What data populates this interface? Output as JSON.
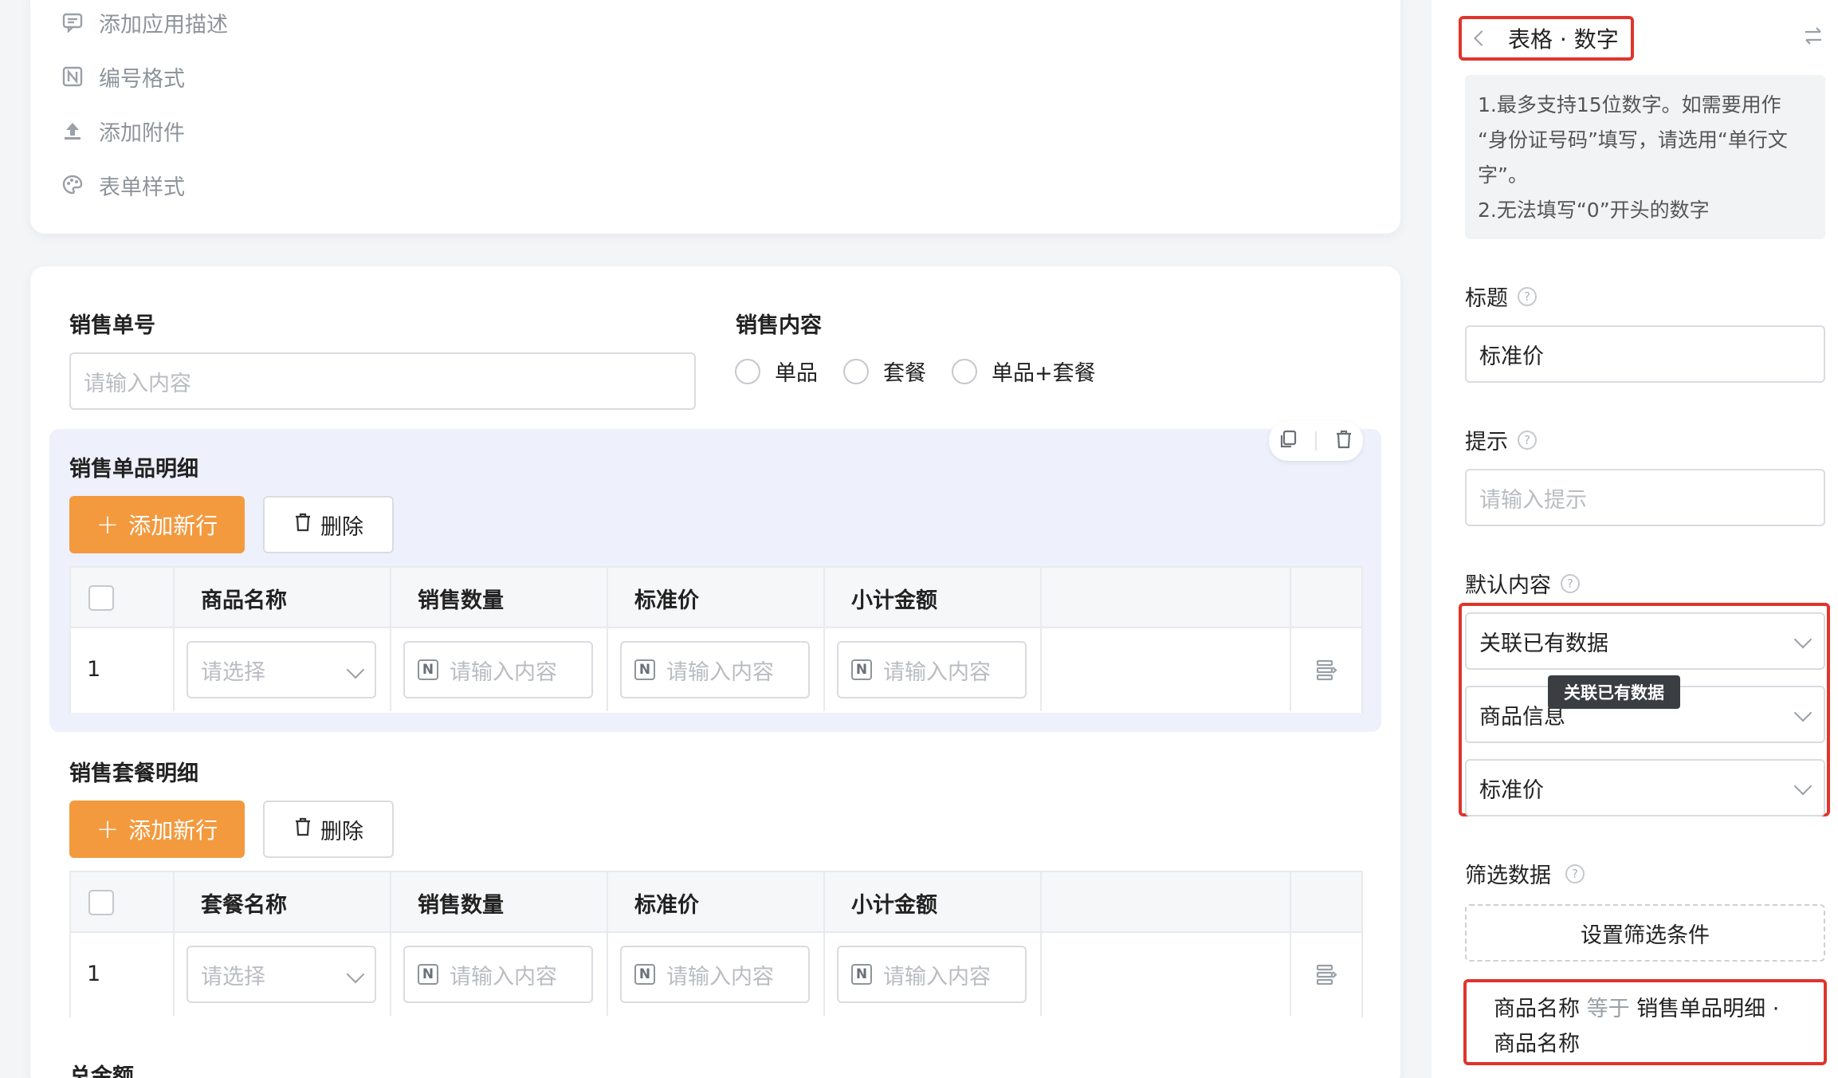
{
  "form_settings_menu": [
    {
      "label": "添加应用描述",
      "icon": "comment-icon"
    },
    {
      "label": "编号格式",
      "icon": "number-format-icon"
    },
    {
      "label": "添加附件",
      "icon": "upload-icon"
    },
    {
      "label": "表单样式",
      "icon": "palette-icon"
    }
  ],
  "form": {
    "order_no_label": "销售单号",
    "order_no_placeholder": "请输入内容",
    "content_label": "销售内容",
    "content_options": [
      "单品",
      "套餐",
      "单品+套餐"
    ]
  },
  "single_table": {
    "title": "销售单品明细",
    "add_label": "添加新行",
    "delete_label": "删除",
    "columns": [
      "商品名称",
      "销售数量",
      "标准价",
      "小计金额"
    ],
    "row_number": "1",
    "select_placeholder": "请选择",
    "input_placeholder": "请输入内容"
  },
  "package_table": {
    "title": "销售套餐明细",
    "add_label": "添加新行",
    "delete_label": "删除",
    "columns": [
      "套餐名称",
      "销售数量",
      "标准价",
      "小计金额"
    ],
    "row_number": "1",
    "select_placeholder": "请选择",
    "input_placeholder": "请输入内容"
  },
  "total_label": "总金额",
  "panel": {
    "breadcrumb": "表格 · 数字",
    "tip_lines": [
      "1.最多支持15位数字。如需要用作",
      "“身份证号码”填写，请选用“单行文",
      "字”。",
      "2.无法填写“0”开头的数字"
    ],
    "title_label": "标题",
    "title_value": "标准价",
    "hint_label": "提示",
    "hint_placeholder": "请输入提示",
    "default_label": "默认内容",
    "default_mode": "关联已有数据",
    "default_source": "商品信息",
    "default_field": "标准价",
    "tooltip": "关联已有数据",
    "filter_label": "筛选数据",
    "filter_button": "设置筛选条件",
    "condition": {
      "field": "商品名称",
      "operator": "等于",
      "value_line1": "销售单品明细 ·",
      "value_line2": "商品名称"
    }
  },
  "colors": {
    "primary": "#f39a3f",
    "highlight_red": "#e0342c",
    "subtable_bg": "#eef0fb"
  }
}
